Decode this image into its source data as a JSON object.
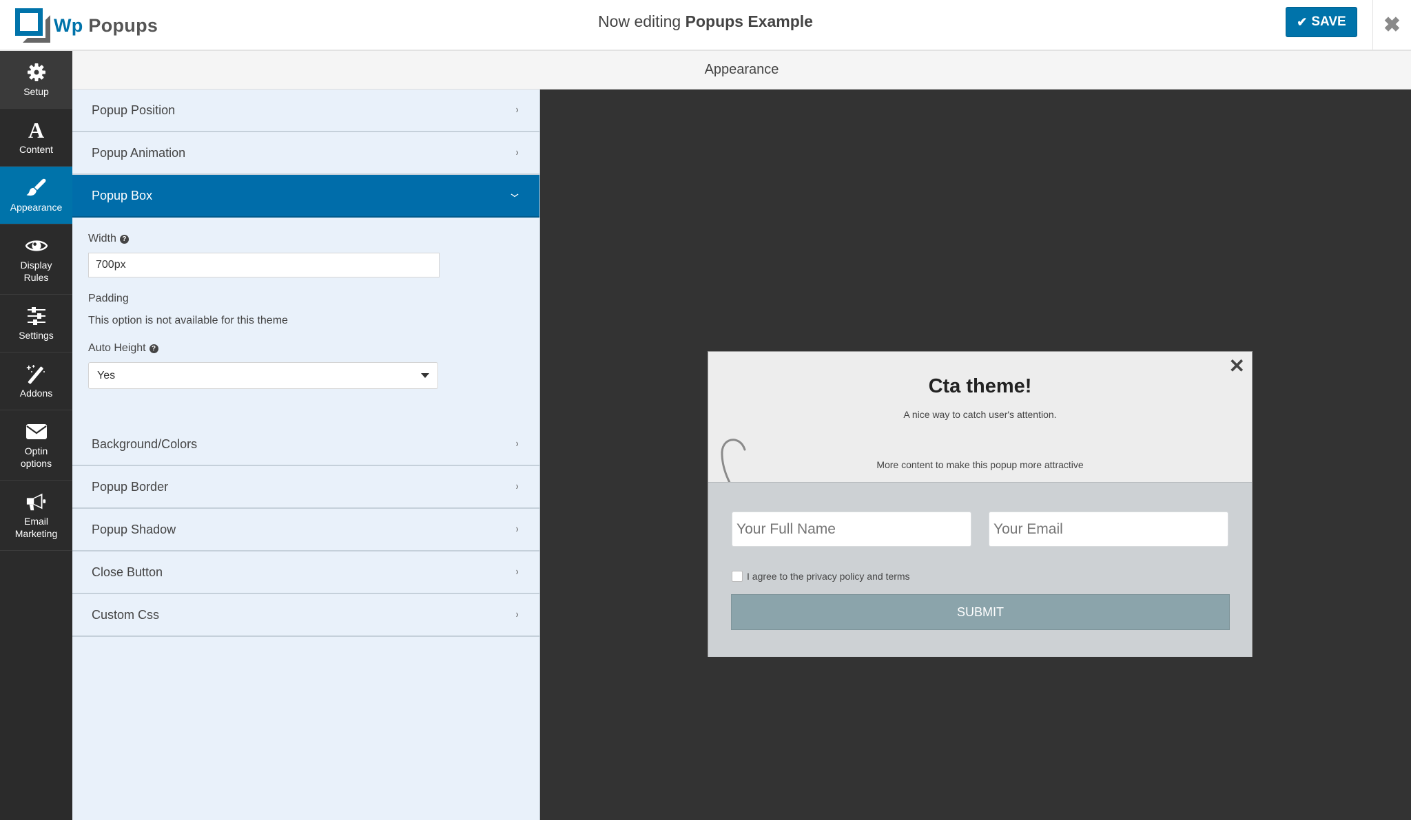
{
  "header": {
    "logo_part1": "Wp",
    "logo_part2": "Popups",
    "editing_prefix": "Now editing",
    "editing_name": "Popups Example",
    "save_icon": "checkmark-icon",
    "save_label": "SAVE",
    "close_icon": "close-icon",
    "close_glyph": "✖"
  },
  "sidebar": {
    "items": [
      {
        "label": "Setup",
        "icon": "gear-icon"
      },
      {
        "label": "Content",
        "icon": "letter-a-icon"
      },
      {
        "label": "Appearance",
        "icon": "paintbrush-icon",
        "active": true
      },
      {
        "label": "Display Rules",
        "line1": "Display",
        "line2": "Rules",
        "icon": "eye-icon"
      },
      {
        "label": "Settings",
        "icon": "sliders-icon"
      },
      {
        "label": "Addons",
        "icon": "magic-wand-icon"
      },
      {
        "label": "Optin options",
        "line1": "Optin",
        "line2": "options",
        "icon": "envelope-icon"
      },
      {
        "label": "Email Marketing",
        "line1": "Email",
        "line2": "Marketing",
        "icon": "megaphone-icon"
      }
    ]
  },
  "panel": {
    "title": "Appearance",
    "sections_before": [
      {
        "label": "Popup Position"
      },
      {
        "label": "Popup Animation"
      }
    ],
    "open_section": {
      "label": "Popup Box",
      "fields": {
        "width_label": "Width",
        "width_value": "700px",
        "padding_label": "Padding",
        "padding_note": "This option is not available for this theme",
        "auto_height_label": "Auto Height",
        "auto_height_value": "Yes"
      }
    },
    "sections_after": [
      {
        "label": "Background/Colors"
      },
      {
        "label": "Popup Border"
      },
      {
        "label": "Popup Shadow"
      },
      {
        "label": "Close Button"
      },
      {
        "label": "Custom Css"
      }
    ],
    "chevron_right": "›",
    "chevron_down": "⌄",
    "help_glyph": "?"
  },
  "preview": {
    "close_glyph": "✕",
    "title": "Cta theme!",
    "subtitle": "A nice way to catch user's attention.",
    "more_content": "More content to make this popup more attractive",
    "name_placeholder": "Your Full Name",
    "email_placeholder": "Your Email",
    "consent_label": "I agree to the privacy policy and terms",
    "consent_checked": false,
    "submit_label": "SUBMIT"
  },
  "colors": {
    "brand_blue": "#0073aa",
    "sidebar_bg": "#2b2b2b",
    "panel_bg": "#e9f1fa",
    "submit_bg": "#8ba4ab"
  }
}
